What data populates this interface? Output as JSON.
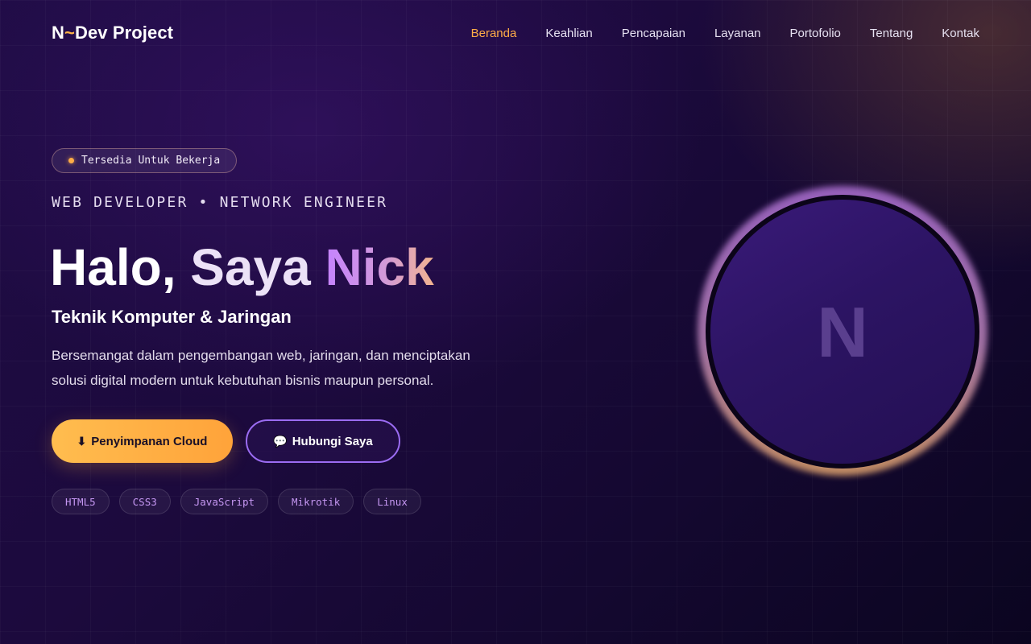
{
  "nav": {
    "logo_prefix": "N",
    "logo_tilde": "~",
    "logo_suffix": "Dev Project",
    "links": [
      {
        "label": "Beranda",
        "active": true
      },
      {
        "label": "Keahlian",
        "active": false
      },
      {
        "label": "Pencapaian",
        "active": false
      },
      {
        "label": "Layanan",
        "active": false
      },
      {
        "label": "Portofolio",
        "active": false
      },
      {
        "label": "Tentang",
        "active": false
      },
      {
        "label": "Kontak",
        "active": false
      }
    ]
  },
  "hero": {
    "badge": "Tersedia Untuk Bekerja",
    "role": "WEB DEVELOPER • NETWORK ENGINEER",
    "headline": {
      "part1": "Halo,",
      "part2": "Saya",
      "part3": "Nick"
    },
    "subtitle": "Teknik Komputer & Jaringan",
    "description": "Bersemangat dalam pengembangan web, jaringan, dan menciptakan solusi digital modern untuk kebutuhan bisnis maupun personal.",
    "primary_button": {
      "icon": "⬇",
      "icon_name": "download-icon",
      "label": "Penyimpanan Cloud"
    },
    "secondary_button": {
      "icon": "💬",
      "icon_name": "chat-bubble-icon",
      "label": "Hubungi Saya"
    },
    "tags": [
      "HTML5",
      "CSS3",
      "JavaScript",
      "Mikrotik",
      "Linux"
    ]
  },
  "avatar": {
    "initial": "N"
  },
  "colors": {
    "accent_orange": "#ffad47",
    "accent_purple": "#9b6cf2",
    "tag_text": "#c597f2",
    "background": "#1c0a3d"
  }
}
